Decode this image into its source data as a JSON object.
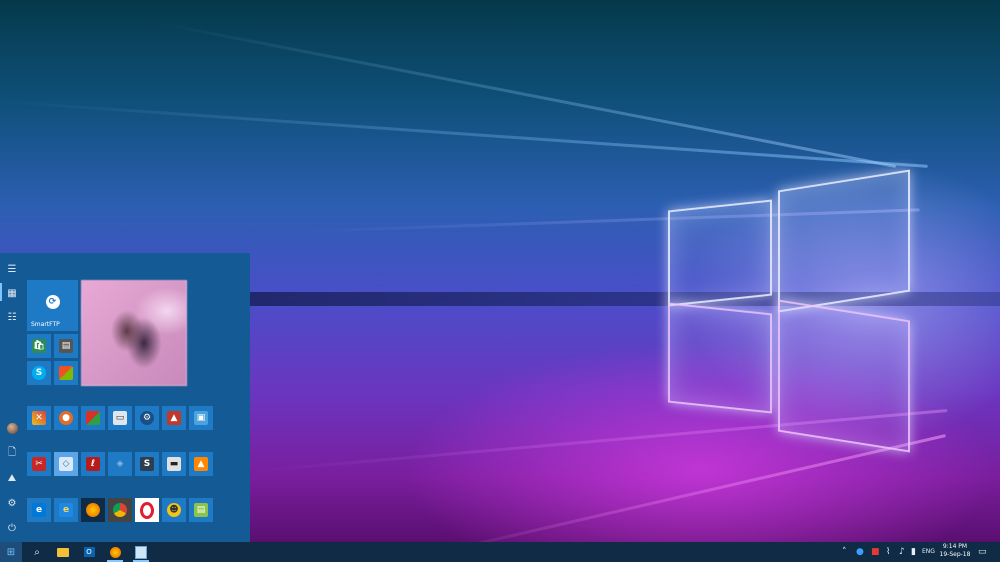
{
  "colors": {
    "accent": "#1f7ac6",
    "start_bg": "#145a94",
    "taskbar_bg": "#0f2b45",
    "active_indicator": "#8cc8ff"
  },
  "start_menu": {
    "rail": [
      {
        "name": "hamburger-icon",
        "glyph": "☰"
      },
      {
        "name": "apps-grid-icon",
        "glyph": "▦"
      },
      {
        "name": "list-icon",
        "glyph": "☷"
      },
      {
        "name": "user-avatar",
        "glyph": ""
      },
      {
        "name": "documents-icon",
        "glyph": "🗋"
      },
      {
        "name": "pictures-icon",
        "glyph": "⛰"
      },
      {
        "name": "settings-gear-icon",
        "glyph": "⚙"
      },
      {
        "name": "power-icon",
        "glyph": "⏻"
      }
    ],
    "tiles": {
      "smartftp_label": "SmartFTP"
    }
  },
  "taskbar": {
    "icons": [
      "windows-logo-icon",
      "search-icon",
      "file-explorer-icon",
      "outlook-icon",
      "firefox-icon",
      "notepad-icon"
    ],
    "tray": {
      "language": "ENG",
      "time": "9:14 PM",
      "date": "19-Sep-18",
      "icons": [
        "chevron-up-icon",
        "network-status-icon",
        "antivirus-icon",
        "wifi-icon",
        "volume-icon",
        "battery-icon",
        "notification-icon"
      ]
    }
  }
}
